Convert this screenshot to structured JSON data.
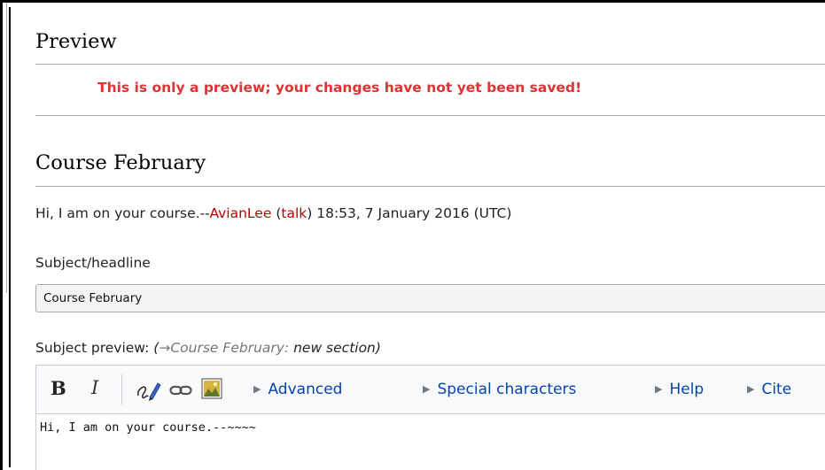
{
  "preview": {
    "title": "Preview",
    "warning": "This is only a preview; your changes have not yet been saved!"
  },
  "section": {
    "title": "Course February",
    "message": "Hi, I am on your course.--",
    "user": "AvianLee",
    "talk_open": "(",
    "talk": "talk",
    "talk_close": ")",
    "timestamp": " 18:53, 7 January 2016 (UTC)"
  },
  "subject": {
    "label": "Subject/headline",
    "value": "Course February",
    "preview_label": "Subject preview:",
    "preview_open": "(",
    "preview_arrow": "→",
    "preview_section": "Course February:",
    "preview_suffix": "new section)"
  },
  "toolbar": {
    "bold": "B",
    "italic": "I",
    "advanced": "Advanced",
    "special_characters": "Special characters",
    "help": "Help",
    "cite": "Cite",
    "icons": [
      "signature-icon",
      "link-icon",
      "image-icon"
    ]
  },
  "editor": {
    "text": "Hi, I am on your course.--~~~~"
  },
  "colors": {
    "warning": "#d33",
    "redlink": "#ba0000",
    "link": "#0645ad"
  }
}
